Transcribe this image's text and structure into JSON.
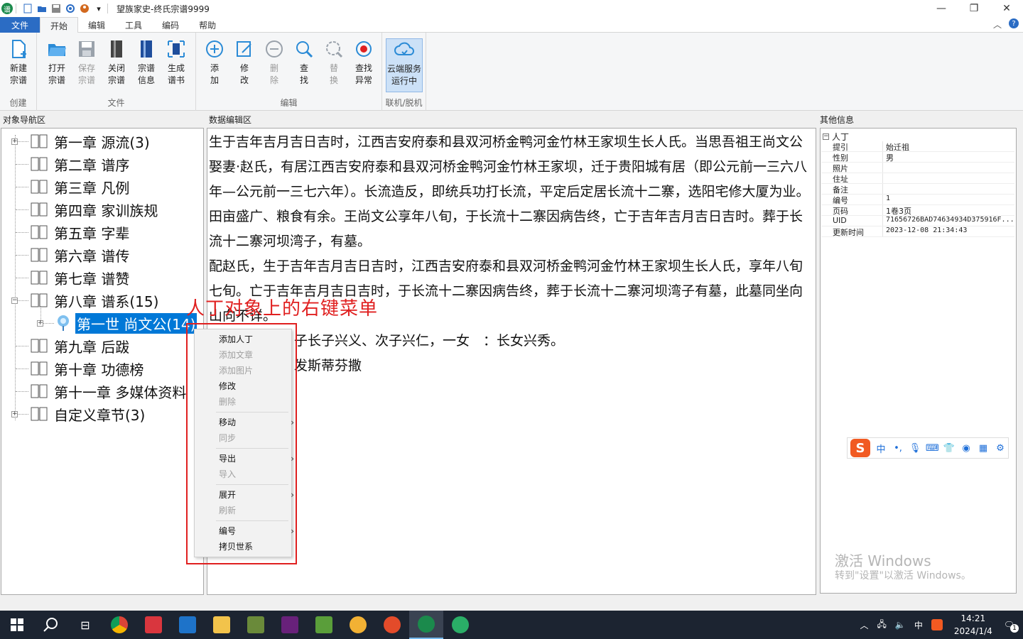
{
  "window": {
    "title": "望族家史-终氏宗谱9999",
    "app_logo_icon": "genealogy-app-icon"
  },
  "tabs": [
    "文件",
    "开始",
    "编辑",
    "工具",
    "编码",
    "帮助"
  ],
  "ribbon": {
    "groups": {
      "create": "创建",
      "file": "文件",
      "edit": "编辑",
      "online": "联机/脱机"
    },
    "buttons": {
      "new": "新建\n宗谱",
      "open": "打开\n宗谱",
      "save": "保存\n宗谱",
      "close": "关闭\n宗谱",
      "info": "宗谱\n信息",
      "generate": "生成\n谱书",
      "add": "添\n加",
      "modify": "修\n改",
      "delete": "删\n除",
      "find": "查\n找",
      "replace": "替\n换",
      "find_error": "查找\n异常",
      "cloud": "云端服务\n运行中"
    }
  },
  "panels": {
    "nav": "对象导航区",
    "editor": "数据编辑区",
    "other": "其他信息"
  },
  "tree": [
    {
      "label": "第一章 源流(3)",
      "expandable": true
    },
    {
      "label": "第二章 谱序",
      "expandable": false
    },
    {
      "label": "第三章 凡例",
      "expandable": false
    },
    {
      "label": "第四章 家训族规",
      "expandable": false
    },
    {
      "label": "第五章 字辈",
      "expandable": false
    },
    {
      "label": "第六章 谱传",
      "expandable": false
    },
    {
      "label": "第七章 谱赞",
      "expandable": false
    },
    {
      "label": "第八章 谱系(15)",
      "expandable": true,
      "expanded": true
    },
    {
      "label": "第一世 尚文公(14)",
      "child": true,
      "selected": true
    },
    {
      "label": "第九章 后跋",
      "expandable": false
    },
    {
      "label": "第十章 功德榜",
      "expandable": false
    },
    {
      "label": "第十一章 多媒体资料",
      "expandable": false
    },
    {
      "label": "自定义章节(3)",
      "expandable": true
    }
  ],
  "editor": {
    "paragraphs": [
      "生于吉年吉月吉日吉时，江西吉安府泰和县双河桥金鸭河金竹林王家坝生长人氏。当思吾祖王尚文公娶妻·赵氏，有居江西吉安府泰和县双河桥金鸭河金竹林王家坝，迁于贵阳城有居（即公元前一三六八年—公元前一三七六年）。长流造反，即统兵功打长流，平定后定居长流十二寨，选阳宅修大厦为业。田亩盛广、粮食有余。王尚文公享年八旬，于长流十二寨因病告终，亡于吉年吉月吉日吉时。葬于长流十二寨河坝湾子，有墓。",
      "配赵氏，生于吉年吉月吉日吉时，江西吉安府泰和县双河桥金鸭河金竹林王家坝生长人氏，享年八旬七旬。亡于吉年吉月吉日吉时，于长流十二寨因病告终，葬于长流十二寨河坝湾子有墓，此墓同坐向山向不详。",
      "子长子兴义、次子兴仁，一女　：长女兴秀。",
      "发斯蒂芬撒"
    ]
  },
  "properties": {
    "section": "人丁",
    "rows": [
      {
        "key": "提引",
        "value": "始迁祖"
      },
      {
        "key": "性别",
        "value": "男"
      },
      {
        "key": "照片",
        "value": ""
      },
      {
        "key": "住址",
        "value": ""
      },
      {
        "key": "备注",
        "value": ""
      },
      {
        "key": "编号",
        "value": "1"
      },
      {
        "key": "页码",
        "value": "1卷3页"
      },
      {
        "key": "UID",
        "value": "71656726BAD74634934D375916F..."
      },
      {
        "key": "更新时间",
        "value": "2023-12-08 21:34:43"
      }
    ]
  },
  "ime": {
    "mode": "中",
    "symbols": "•,"
  },
  "watermark": {
    "line1": "激活 Windows",
    "line2": "转到\"设置\"以激活 Windows。"
  },
  "annotation": "人丁对象上的右键菜单",
  "context_menu": [
    {
      "label": "添加人丁",
      "enabled": true
    },
    {
      "label": "添加文章",
      "enabled": false
    },
    {
      "label": "添加图片",
      "enabled": false
    },
    {
      "label": "修改",
      "enabled": true
    },
    {
      "label": "删除",
      "enabled": false
    },
    {
      "label": "移动",
      "enabled": true,
      "submenu": true
    },
    {
      "label": "同步",
      "enabled": false
    },
    {
      "label": "导出",
      "enabled": true,
      "submenu": true
    },
    {
      "label": "导入",
      "enabled": false
    },
    {
      "label": "展开",
      "enabled": true,
      "submenu": true
    },
    {
      "label": "刷新",
      "enabled": false
    },
    {
      "label": "编号",
      "enabled": true,
      "submenu": true
    },
    {
      "label": "拷贝世系",
      "enabled": true
    }
  ],
  "taskbar": {
    "ime_indicator": "中",
    "time": "14:21",
    "date": "2024/1/4",
    "notification_count": "1"
  }
}
